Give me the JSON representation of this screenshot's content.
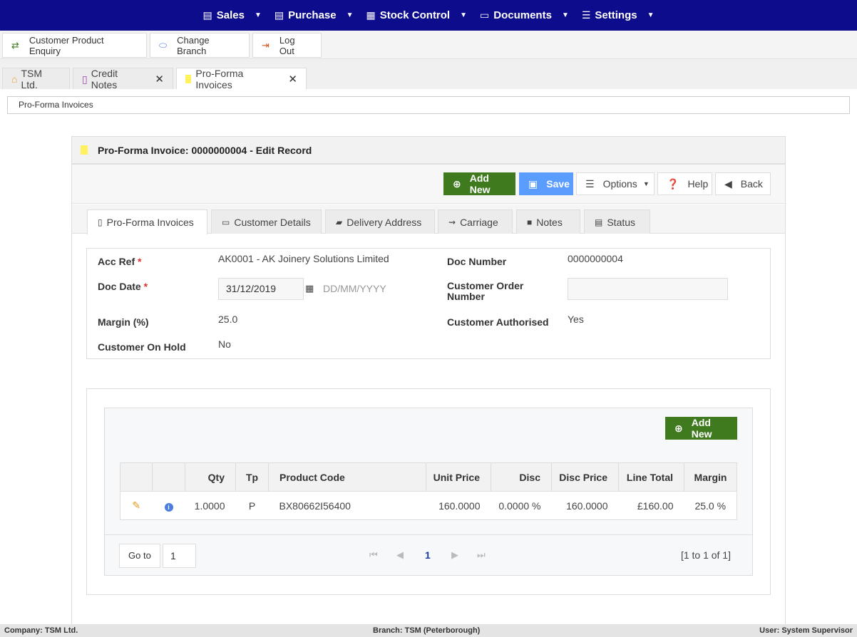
{
  "nav": {
    "items": [
      {
        "label": "Sales",
        "icon": "sales-icon"
      },
      {
        "label": "Purchase",
        "icon": "purchase-icon"
      },
      {
        "label": "Stock Control",
        "icon": "stock-icon"
      },
      {
        "label": "Documents",
        "icon": "folder-icon"
      },
      {
        "label": "Settings",
        "icon": "settings-icon"
      }
    ]
  },
  "actions": {
    "enquiry": "Customer Product Enquiry",
    "change_branch": "Change Branch",
    "logout": "Log Out"
  },
  "page_tabs": [
    {
      "label": "TSM Ltd.",
      "icon": "home-icon"
    },
    {
      "label": "Credit Notes",
      "icon": "document-icon"
    },
    {
      "label": "Pro-Forma Invoices",
      "icon": "note-icon"
    }
  ],
  "breadcrumb": "Pro-Forma Invoices",
  "record": {
    "title": "Pro-Forma Invoice: 0000000004 - Edit Record"
  },
  "toolbar": {
    "add_new": "Add New",
    "save": "Save",
    "options": "Options",
    "help": "Help",
    "back": "Back"
  },
  "form_tabs": [
    {
      "label": "Pro-Forma Invoices"
    },
    {
      "label": "Customer Details"
    },
    {
      "label": "Delivery Address"
    },
    {
      "label": "Carriage"
    },
    {
      "label": "Notes"
    },
    {
      "label": "Status"
    }
  ],
  "form": {
    "acc_ref_label": "Acc Ref",
    "acc_ref_value": "AK0001 - AK Joinery Solutions Limited",
    "doc_number_label": "Doc Number",
    "doc_number_value": "0000000004",
    "doc_date_label": "Doc Date",
    "doc_date_value": "31/12/2019",
    "doc_date_format": "DD/MM/YYYY",
    "cust_order_label_1": "Customer Order",
    "cust_order_label_2": "Number",
    "cust_order_value": "",
    "margin_label": "Margin (%)",
    "margin_value": "25.0",
    "cust_auth_label": "Customer Authorised",
    "cust_auth_value": "Yes",
    "on_hold_label": "Customer On Hold",
    "on_hold_value": "No",
    "required_mark": "*"
  },
  "grid": {
    "add_new": "Add New",
    "columns": [
      "",
      "",
      "Qty",
      "Tp",
      "Product Code",
      "Unit Price",
      "Disc",
      "Disc Price",
      "Line Total",
      "Margin"
    ],
    "rows": [
      {
        "qty": "1.0000",
        "tp": "P",
        "product_code": "BX80662I56400",
        "unit_price": "160.0000",
        "disc": "0.0000 %",
        "disc_price": "160.0000",
        "line_total": "£160.00",
        "margin": "25.0 %"
      }
    ],
    "goto_label": "Go to",
    "page_input": "1",
    "current_page": "1",
    "page_info": "[1 to 1 of 1]"
  },
  "status": {
    "company": "Company: TSM Ltd.",
    "branch": "Branch: TSM (Peterborough)",
    "user": "User: System Supervisor"
  },
  "colors": {
    "nav_bg": "#0c0c8c",
    "add_new_green": "#3f7a1f",
    "save_blue": "#5b9cff"
  }
}
